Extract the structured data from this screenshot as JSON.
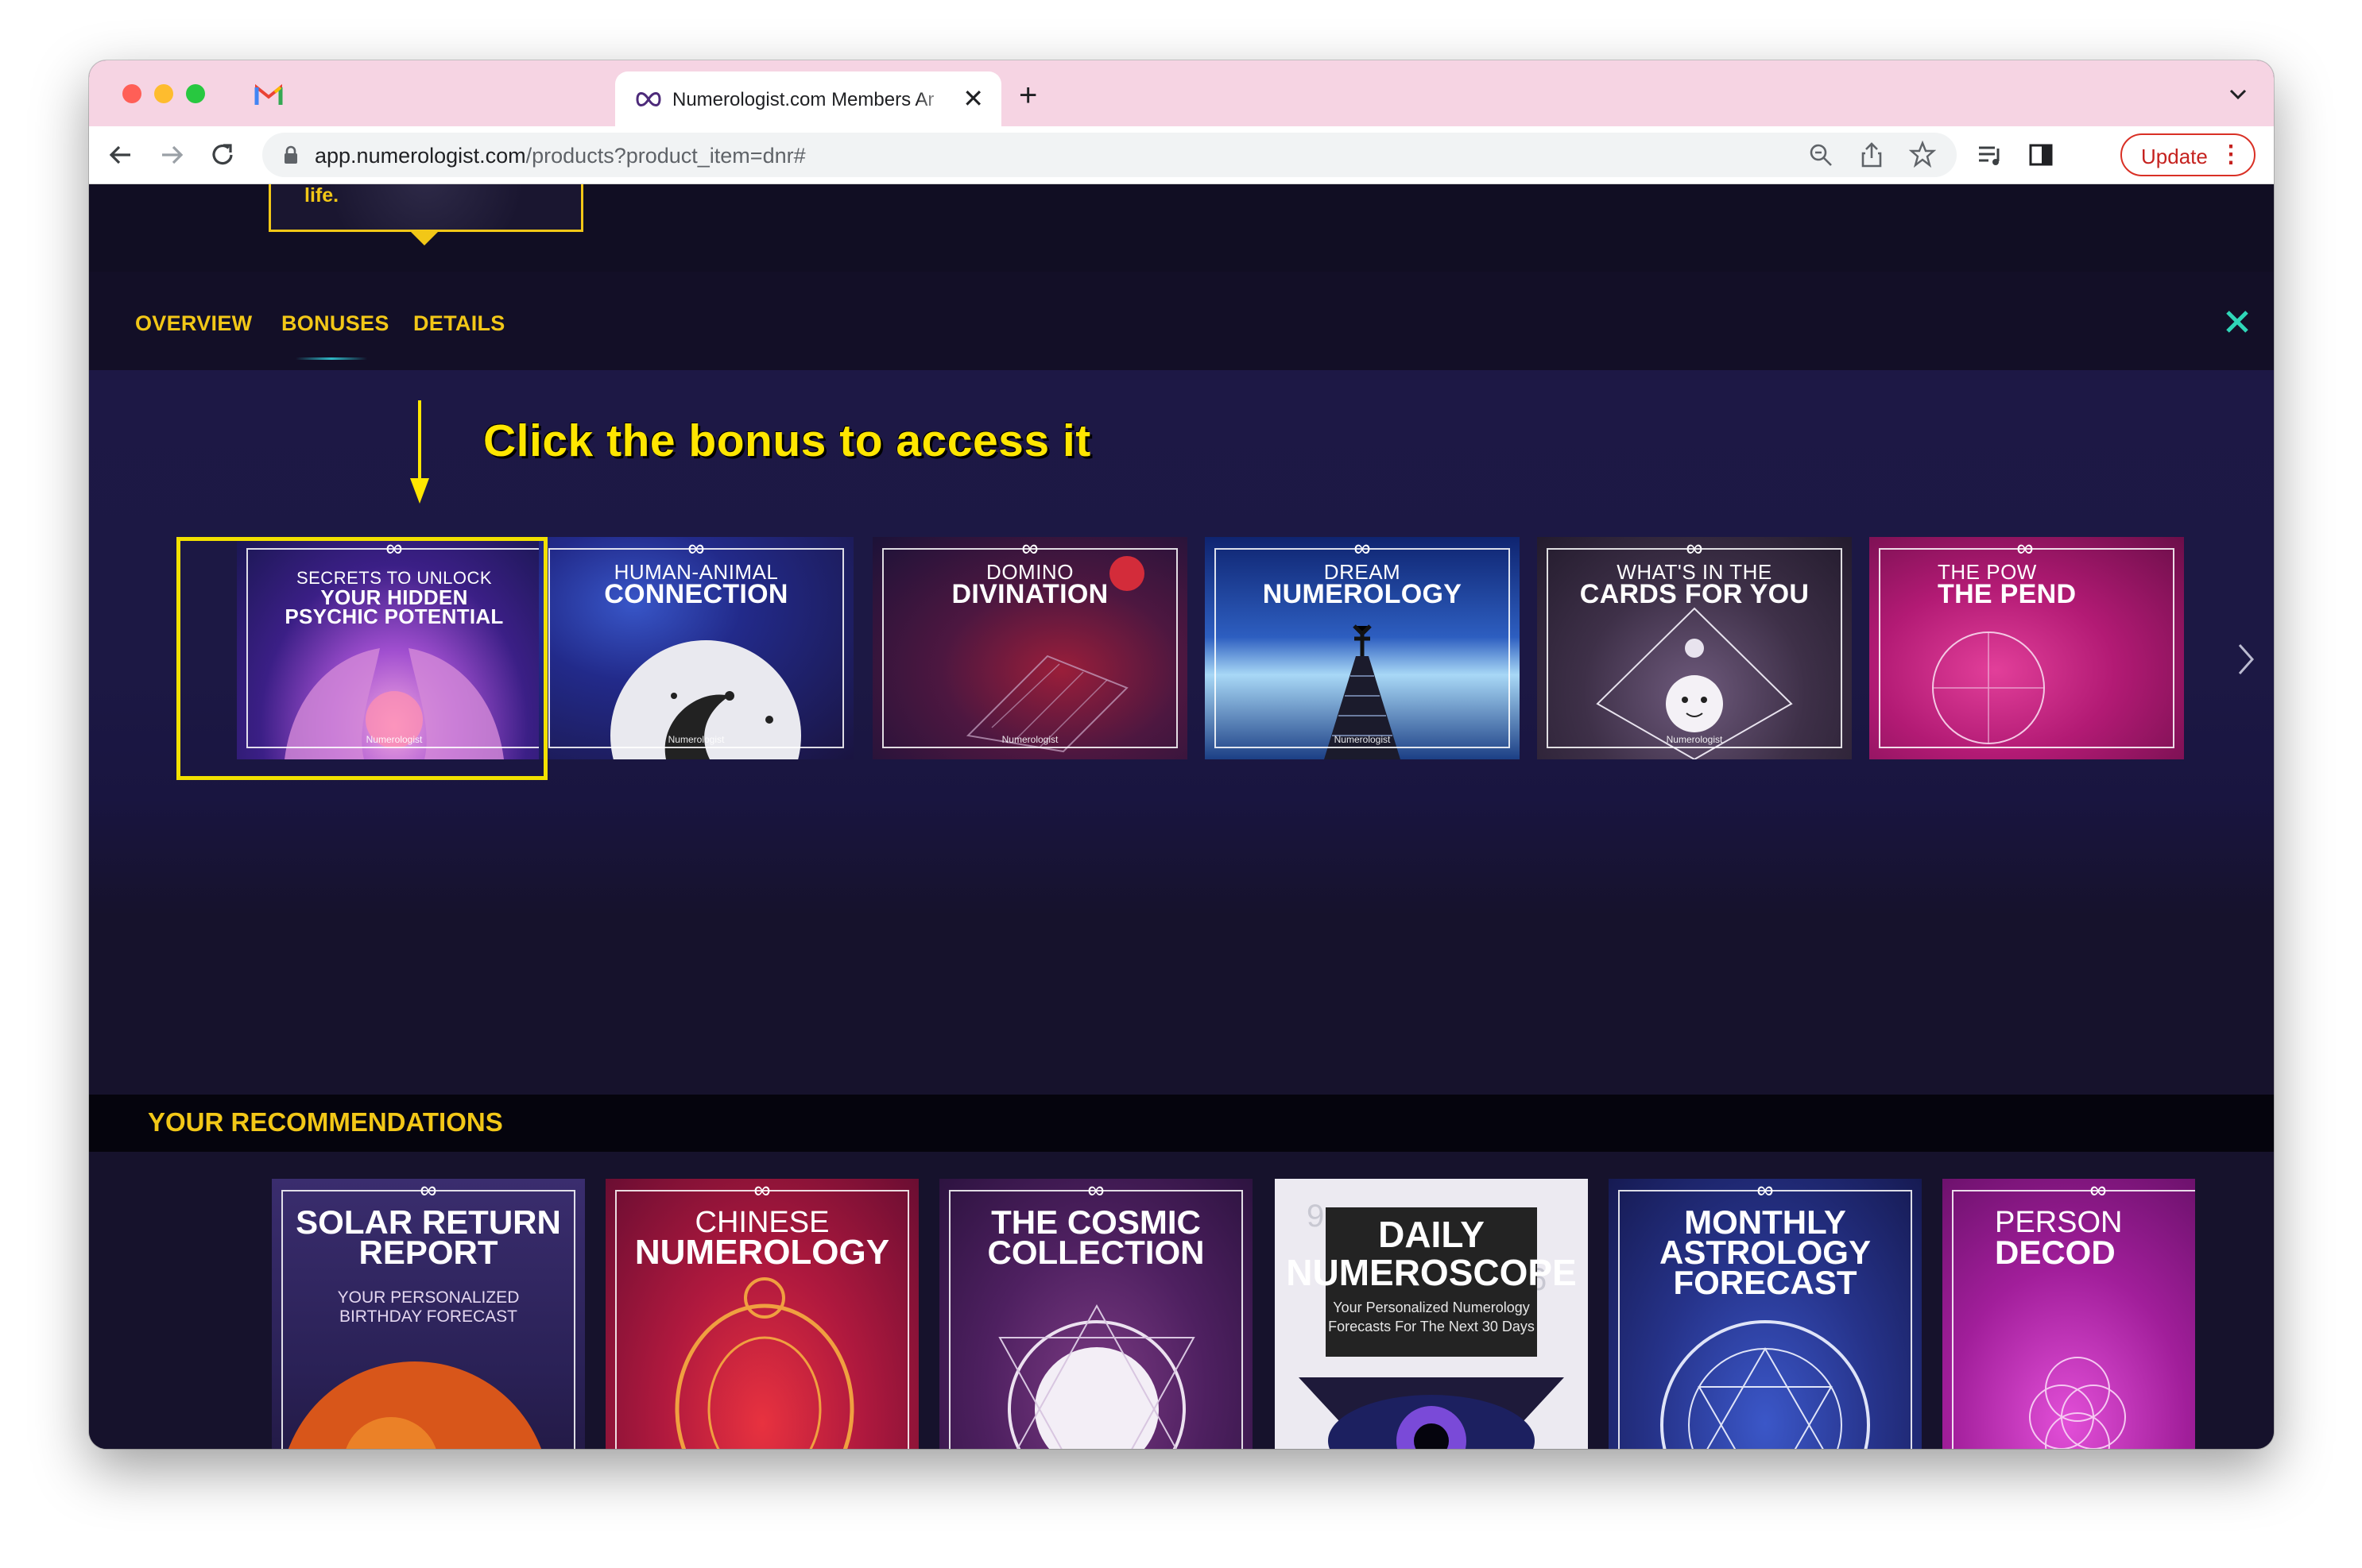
{
  "browser": {
    "tab_title": "Numerologist.com Members Ar",
    "url_host": "app.numerologist.com",
    "url_path": "/products?product_item=dnr#",
    "update_label": "Update"
  },
  "page": {
    "popup_text": "life.",
    "nav_tabs": [
      "OVERVIEW",
      "BONUSES",
      "DETAILS"
    ],
    "hint": "Click the bonus to access it",
    "bonuses": [
      {
        "l1": "SECRETS TO UNLOCK",
        "l2": "YOUR HIDDEN",
        "l3": "PSYCHIC POTENTIAL"
      },
      {
        "l1": "HUMAN-ANIMAL",
        "l2": "CONNECTION"
      },
      {
        "l1": "DOMINO",
        "l2": "DIVINATION"
      },
      {
        "l1": "DREAM",
        "l2": "NUMEROLOGY"
      },
      {
        "l1": "WHAT'S IN THE",
        "l2": "CARDS FOR YOU"
      },
      {
        "l1": "THE POW",
        "l2": "THE PEND"
      }
    ],
    "card_brand": "Numerologist",
    "recommendations_title": "YOUR RECOMMENDATIONS",
    "recommendations": [
      {
        "l1": "SOLAR RETURN",
        "l2": "REPORT",
        "sub1": "YOUR PERSONALIZED",
        "sub2": "BIRTHDAY FORECAST"
      },
      {
        "l1": "CHINESE",
        "l2": "NUMEROLOGY"
      },
      {
        "l1": "THE COSMIC",
        "l2": "COLLECTION"
      },
      {
        "l1": "DAILY",
        "l2": "NUMEROSCOPE",
        "sub1": "Your Personalized Numerology",
        "sub2": "Forecasts For The Next 30 Days"
      },
      {
        "l1": "MONTHLY",
        "l2": "ASTROLOGY",
        "l3": "FORECAST"
      },
      {
        "l1": "PERSON",
        "l2": "DECOD"
      }
    ]
  },
  "colors": {
    "accent_gold": "#f2c717",
    "hint_yellow": "#ffe600",
    "close_teal": "#2fd6b8",
    "update_red": "#d93025",
    "tabstrip_pink": "#f6d4e3"
  },
  "icons": [
    "gmail-icon",
    "infinity-logo-icon",
    "back-arrow-icon",
    "forward-arrow-icon",
    "reload-icon",
    "lock-icon",
    "zoom-icon",
    "share-icon",
    "star-icon",
    "media-icon",
    "sidepanel-icon",
    "close-icon",
    "chevron-right-icon",
    "arrow-down-icon"
  ]
}
